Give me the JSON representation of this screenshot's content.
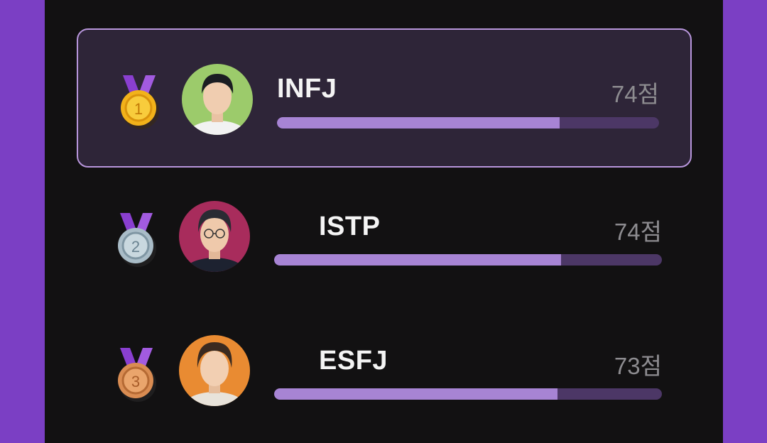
{
  "colors": {
    "outer_bg": "#7b3fc4",
    "panel_bg": "#121112",
    "highlight_bg": "#2e2538",
    "highlight_border": "#b896dc",
    "bar_fill": "#a784d4",
    "bar_track": "#4c3766"
  },
  "ranking": [
    {
      "rank": "1",
      "medal": "gold-medal-icon",
      "name": "INFJ",
      "score": "74점",
      "fill_fraction": 0.74,
      "avatar_bg": "#9ccb6b",
      "hair": "#1b1d22",
      "shirt": "#f2f2f2",
      "highlighted": true
    },
    {
      "rank": "2",
      "medal": "silver-medal-icon",
      "name": "ISTP",
      "score": "74점",
      "fill_fraction": 0.74,
      "avatar_bg": "#a82c5c",
      "hair": "#2a2b33",
      "shirt": "#1d2230",
      "highlighted": false
    },
    {
      "rank": "3",
      "medal": "bronze-medal-icon",
      "name": "ESFJ",
      "score": "73점",
      "fill_fraction": 0.73,
      "avatar_bg": "#e98b32",
      "hair": "#3a2a20",
      "shirt": "#e8e3da",
      "highlighted": false
    }
  ]
}
